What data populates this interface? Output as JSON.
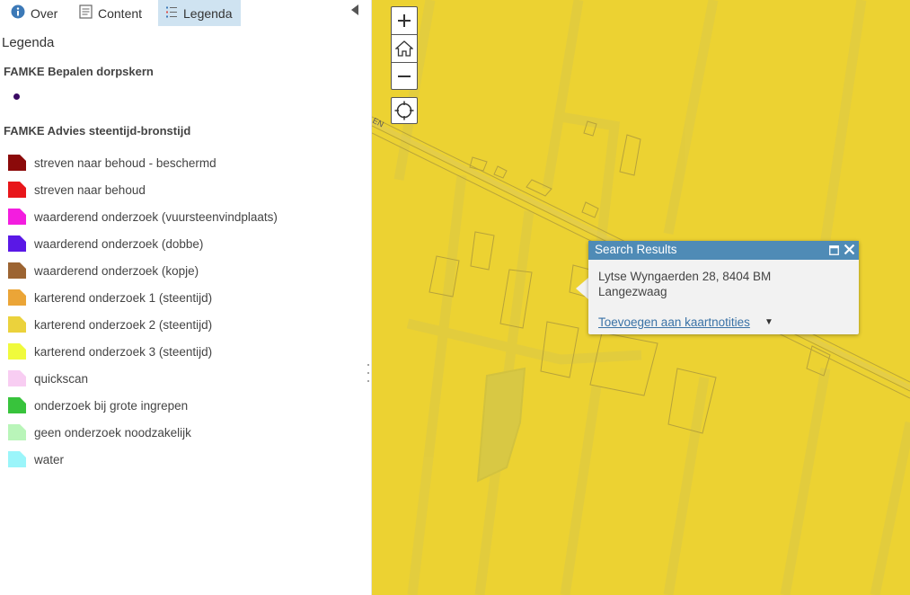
{
  "tabs": [
    {
      "label": "Over",
      "icon": "info-icon"
    },
    {
      "label": "Content",
      "icon": "content-icon"
    },
    {
      "label": "Legenda",
      "icon": "legend-list-icon",
      "active": true
    }
  ],
  "panel": {
    "title": "Legenda",
    "layers": [
      {
        "title": "FAMKE Bepalen dorpskern",
        "symbol_color": "#3a0a63",
        "items": []
      },
      {
        "title": "FAMKE Advies steentijd-bronstijd",
        "items": [
          {
            "label": "streven naar behoud - beschermd",
            "color": "#8b0a0a"
          },
          {
            "label": "streven naar behoud",
            "color": "#e8161a"
          },
          {
            "label": "waarderend onderzoek (vuursteenvindplaats)",
            "color": "#f31ddf"
          },
          {
            "label": "waarderend onderzoek (dobbe)",
            "color": "#5a18e6"
          },
          {
            "label": "waarderend onderzoek (kopje)",
            "color": "#9c6432"
          },
          {
            "label": "karterend onderzoek 1 (steentijd)",
            "color": "#eba537"
          },
          {
            "label": "karterend onderzoek 2 (steentijd)",
            "color": "#ebd23c"
          },
          {
            "label": "karterend onderzoek 3 (steentijd)",
            "color": "#f0fa3c"
          },
          {
            "label": "quickscan",
            "color": "#f8cdf2"
          },
          {
            "label": "onderzoek bij grote ingrepen",
            "color": "#38c33c"
          },
          {
            "label": "geen onderzoek noodzakelijk",
            "color": "#b9f5b9"
          },
          {
            "label": "water",
            "color": "#9bf5fa"
          }
        ]
      }
    ]
  },
  "map": {
    "background_color": "#ecd232",
    "road_label": "EN",
    "controls": {
      "zoom_in": "zoom-in-icon",
      "home": "home-icon",
      "zoom_out": "zoom-out-icon",
      "locate": "locate-icon"
    }
  },
  "popup": {
    "title": "Search Results",
    "address_line": "Lytse Wyngaerden 28, 8404 BM Langezwaag",
    "action_link": "Toevoegen aan kaartnotities",
    "header_color": "#4f8bb6"
  }
}
